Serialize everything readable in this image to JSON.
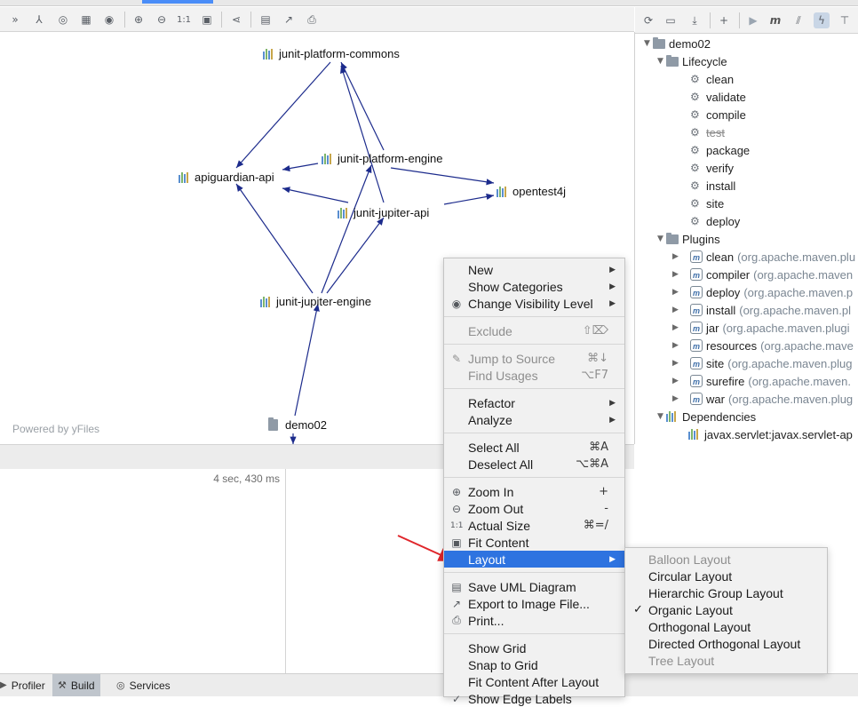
{
  "diagram": {
    "nodes": [
      {
        "id": "commons",
        "label": "junit-platform-commons"
      },
      {
        "id": "apiguardian",
        "label": "apiguardian-api"
      },
      {
        "id": "platform_engine",
        "label": "junit-platform-engine"
      },
      {
        "id": "opentest4j",
        "label": "opentest4j"
      },
      {
        "id": "jupiter_api",
        "label": "junit-jupiter-api"
      },
      {
        "id": "jupiter_engine",
        "label": "junit-jupiter-engine"
      },
      {
        "id": "demo02",
        "label": "demo02"
      }
    ],
    "powered_by": "Powered by yFiles"
  },
  "build": {
    "elapsed": "4 sec, 430 ms"
  },
  "bottom_bar": {
    "profiler": "Profiler",
    "build": "Build",
    "services": "Services"
  },
  "maven": {
    "root": "demo02",
    "lifecycle_label": "Lifecycle",
    "lifecycle": [
      "clean",
      "validate",
      "compile",
      "test",
      "package",
      "verify",
      "install",
      "site",
      "deploy"
    ],
    "plugins_label": "Plugins",
    "plugins": [
      {
        "name": "clean",
        "group": "(org.apache.maven.plu"
      },
      {
        "name": "compiler",
        "group": "(org.apache.maven"
      },
      {
        "name": "deploy",
        "group": "(org.apache.maven.p"
      },
      {
        "name": "install",
        "group": "(org.apache.maven.pl"
      },
      {
        "name": "jar",
        "group": "(org.apache.maven.plugi"
      },
      {
        "name": "resources",
        "group": "(org.apache.mave"
      },
      {
        "name": "site",
        "group": "(org.apache.maven.plug"
      },
      {
        "name": "surefire",
        "group": "(org.apache.maven."
      },
      {
        "name": "war",
        "group": "(org.apache.maven.plug"
      }
    ],
    "dependencies_label": "Dependencies",
    "dependency_first": "javax.servlet:javax.servlet-ap"
  },
  "context_menu": {
    "new": "New",
    "show_categories": "Show Categories",
    "change_visibility": "Change Visibility Level",
    "exclude": "Exclude",
    "exclude_sc": "⇧⌦",
    "jump_to_source": "Jump to Source",
    "jump_sc": "⌘↓",
    "find_usages": "Find Usages",
    "find_sc": "⌥F7",
    "refactor": "Refactor",
    "analyze": "Analyze",
    "select_all": "Select All",
    "select_all_sc": "⌘A",
    "deselect_all": "Deselect All",
    "deselect_sc": "⌥⌘A",
    "zoom_in": "Zoom In",
    "zoom_in_sc": "+",
    "zoom_out": "Zoom Out",
    "zoom_out_sc": "-",
    "actual_size": "Actual Size",
    "actual_sc": "⌘=/",
    "fit_content": "Fit Content",
    "layout": "Layout",
    "save_uml": "Save UML Diagram",
    "export_image": "Export to Image File...",
    "print": "Print...",
    "show_grid": "Show Grid",
    "snap_to_grid": "Snap to Grid",
    "fit_after_layout": "Fit Content After Layout",
    "show_edge_labels": "Show Edge Labels"
  },
  "layout_submenu": {
    "balloon": "Balloon Layout",
    "circular": "Circular Layout",
    "hierarchic": "Hierarchic Group Layout",
    "organic": "Organic Layout",
    "orthogonal": "Orthogonal Layout",
    "directed_orthogonal": "Directed Orthogonal Layout",
    "tree": "Tree Layout",
    "checked": "Organic Layout"
  },
  "icons": [
    "collapse-icon",
    "layout-tree-icon",
    "fit-icon",
    "grid-icon",
    "eye-icon",
    "zoom-in-icon",
    "zoom-out-icon",
    "actual-size-icon",
    "export-icon",
    "save-icon",
    "share-icon",
    "print-icon",
    "refresh-icon",
    "add-icon",
    "run-icon",
    "maven-m-icon",
    "toggle-offline-icon",
    "lightning-icon",
    "settings-icon"
  ],
  "colors": {
    "selection": "#2e73e0",
    "edge": "#1c2b8c",
    "arrow_annotation": "#e0262b"
  }
}
